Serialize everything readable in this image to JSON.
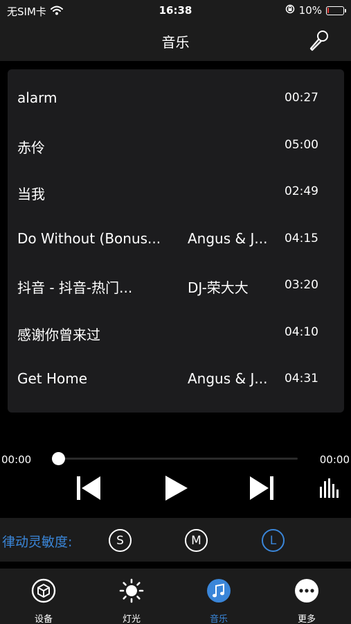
{
  "status_bar": {
    "carrier": "无SIM卡",
    "time": "16:38",
    "battery_percent": "10%",
    "battery_level": 0.1,
    "battery_color": "#e53935"
  },
  "nav": {
    "title": "音乐",
    "mic_icon": "microphone-icon"
  },
  "songs": [
    {
      "title": "alarm",
      "artist": "",
      "duration": "00:27"
    },
    {
      "title": "赤伶",
      "artist": "",
      "duration": "05:00"
    },
    {
      "title": "当我",
      "artist": "",
      "duration": "02:49"
    },
    {
      "title": "Do Without (Bonus...",
      "artist": "Angus & J...",
      "duration": "04:15"
    },
    {
      "title": "抖音 - 抖音-热门...",
      "artist": "DJ-荣大大",
      "duration": "03:20"
    },
    {
      "title": "感谢你曾来过",
      "artist": "",
      "duration": "04:10"
    },
    {
      "title": "Get Home",
      "artist": "Angus & J...",
      "duration": "04:31"
    }
  ],
  "player": {
    "current_time": "00:00",
    "total_time": "00:00",
    "progress": 0
  },
  "sensitivity": {
    "label": "律动灵敏度:",
    "options": [
      "S",
      "M",
      "L"
    ],
    "selected": "L"
  },
  "tabs": [
    {
      "label": "设备",
      "icon": "device-cube-icon"
    },
    {
      "label": "灯光",
      "icon": "sun-icon"
    },
    {
      "label": "音乐",
      "icon": "music-note-icon"
    },
    {
      "label": "更多",
      "icon": "more-dots-icon"
    }
  ],
  "colors": {
    "accent": "#3a86d9",
    "panel": "#1c1c1e",
    "background": "#000000"
  }
}
